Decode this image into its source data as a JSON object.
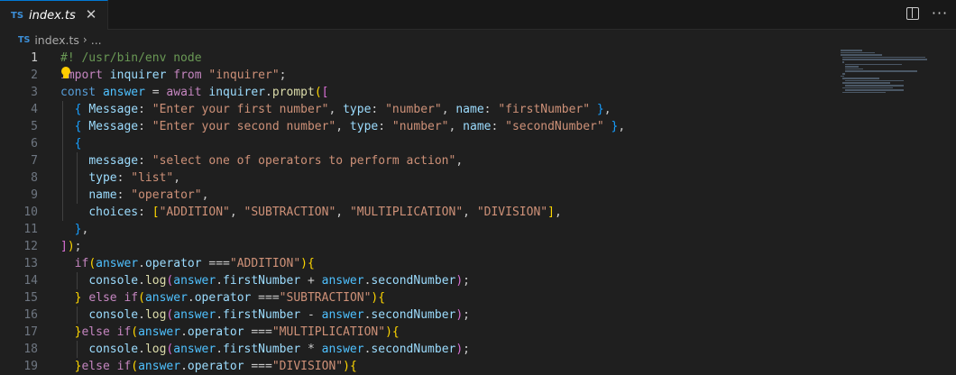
{
  "tab": {
    "icon_label": "TS",
    "file_name": "index.ts",
    "close_glyph": "✕"
  },
  "toolbar": {
    "split_icon": "split-editor-icon",
    "more_glyph": "···"
  },
  "breadcrumb": {
    "icon_label": "TS",
    "file": "index.ts",
    "separator": "›",
    "rest": "..."
  },
  "editor": {
    "active_line": 1,
    "lines": [
      {
        "n": "1",
        "tokens": [
          [
            "comment",
            "#! /usr/bin/env node"
          ]
        ]
      },
      {
        "n": "2",
        "tokens": [
          [
            "keyword",
            "import"
          ],
          [
            "punct",
            " "
          ],
          [
            "var",
            "inquirer"
          ],
          [
            "punct",
            " "
          ],
          [
            "keyword",
            "from"
          ],
          [
            "punct",
            " "
          ],
          [
            "string",
            "\"inquirer\""
          ],
          [
            "punct",
            ";"
          ]
        ]
      },
      {
        "n": "3",
        "tokens": [
          [
            "storage",
            "const"
          ],
          [
            "punct",
            " "
          ],
          [
            "const",
            "answer"
          ],
          [
            "punct",
            " = "
          ],
          [
            "keyword",
            "await"
          ],
          [
            "punct",
            " "
          ],
          [
            "var",
            "inquirer"
          ],
          [
            "punct",
            "."
          ],
          [
            "fn",
            "prompt"
          ],
          [
            "bracket1",
            "("
          ],
          [
            "bracket2",
            "["
          ]
        ]
      },
      {
        "n": "4",
        "tokens": [
          [
            "punct",
            "  "
          ],
          [
            "bracket3",
            "{"
          ],
          [
            "punct",
            " "
          ],
          [
            "var",
            "Message"
          ],
          [
            "punct",
            ": "
          ],
          [
            "string",
            "\"Enter your first number\""
          ],
          [
            "punct",
            ", "
          ],
          [
            "var",
            "type"
          ],
          [
            "punct",
            ": "
          ],
          [
            "string",
            "\"number\""
          ],
          [
            "punct",
            ", "
          ],
          [
            "var",
            "name"
          ],
          [
            "punct",
            ": "
          ],
          [
            "string",
            "\"firstNumber\""
          ],
          [
            "punct",
            " "
          ],
          [
            "bracket3",
            "}"
          ],
          [
            "punct",
            ","
          ]
        ]
      },
      {
        "n": "5",
        "tokens": [
          [
            "punct",
            "  "
          ],
          [
            "bracket3",
            "{"
          ],
          [
            "punct",
            " "
          ],
          [
            "var",
            "Message"
          ],
          [
            "punct",
            ": "
          ],
          [
            "string",
            "\"Enter your second number\""
          ],
          [
            "punct",
            ", "
          ],
          [
            "var",
            "type"
          ],
          [
            "punct",
            ": "
          ],
          [
            "string",
            "\"number\""
          ],
          [
            "punct",
            ", "
          ],
          [
            "var",
            "name"
          ],
          [
            "punct",
            ": "
          ],
          [
            "string",
            "\"secondNumber\""
          ],
          [
            "punct",
            " "
          ],
          [
            "bracket3",
            "}"
          ],
          [
            "punct",
            ","
          ]
        ]
      },
      {
        "n": "6",
        "tokens": [
          [
            "punct",
            "  "
          ],
          [
            "bracket3",
            "{"
          ]
        ]
      },
      {
        "n": "7",
        "tokens": [
          [
            "punct",
            "    "
          ],
          [
            "var",
            "message"
          ],
          [
            "punct",
            ": "
          ],
          [
            "string",
            "\"select one of operators to perform action\""
          ],
          [
            "punct",
            ","
          ]
        ]
      },
      {
        "n": "8",
        "tokens": [
          [
            "punct",
            "    "
          ],
          [
            "var",
            "type"
          ],
          [
            "punct",
            ": "
          ],
          [
            "string",
            "\"list\""
          ],
          [
            "punct",
            ","
          ]
        ]
      },
      {
        "n": "9",
        "tokens": [
          [
            "punct",
            "    "
          ],
          [
            "var",
            "name"
          ],
          [
            "punct",
            ": "
          ],
          [
            "string",
            "\"operator\""
          ],
          [
            "punct",
            ","
          ]
        ]
      },
      {
        "n": "10",
        "tokens": [
          [
            "punct",
            "    "
          ],
          [
            "var",
            "choices"
          ],
          [
            "punct",
            ": "
          ],
          [
            "bracket1",
            "["
          ],
          [
            "string",
            "\"ADDITION\""
          ],
          [
            "punct",
            ", "
          ],
          [
            "string",
            "\"SUBTRACTION\""
          ],
          [
            "punct",
            ", "
          ],
          [
            "string",
            "\"MULTIPLICATION\""
          ],
          [
            "punct",
            ", "
          ],
          [
            "string",
            "\"DIVISION\""
          ],
          [
            "bracket1",
            "]"
          ],
          [
            "punct",
            ","
          ]
        ]
      },
      {
        "n": "11",
        "tokens": [
          [
            "punct",
            "  "
          ],
          [
            "bracket3",
            "}"
          ],
          [
            "punct",
            ","
          ]
        ]
      },
      {
        "n": "12",
        "tokens": [
          [
            "bracket2",
            "]"
          ],
          [
            "bracket1",
            ")"
          ],
          [
            "punct",
            ";"
          ]
        ]
      },
      {
        "n": "13",
        "tokens": [
          [
            "punct",
            "  "
          ],
          [
            "keyword",
            "if"
          ],
          [
            "bracket1",
            "("
          ],
          [
            "const",
            "answer"
          ],
          [
            "punct",
            "."
          ],
          [
            "var",
            "operator"
          ],
          [
            "punct",
            " ==="
          ],
          [
            "string",
            "\"ADDITION\""
          ],
          [
            "bracket1",
            ")"
          ],
          [
            "bracket1",
            "{"
          ]
        ]
      },
      {
        "n": "14",
        "tokens": [
          [
            "punct",
            "    "
          ],
          [
            "var",
            "console"
          ],
          [
            "punct",
            "."
          ],
          [
            "fn",
            "log"
          ],
          [
            "bracket2",
            "("
          ],
          [
            "const",
            "answer"
          ],
          [
            "punct",
            "."
          ],
          [
            "var",
            "firstNumber"
          ],
          [
            "punct",
            " + "
          ],
          [
            "const",
            "answer"
          ],
          [
            "punct",
            "."
          ],
          [
            "var",
            "secondNumber"
          ],
          [
            "bracket2",
            ")"
          ],
          [
            "punct",
            ";"
          ]
        ]
      },
      {
        "n": "15",
        "tokens": [
          [
            "punct",
            "  "
          ],
          [
            "bracket1",
            "}"
          ],
          [
            "punct",
            " "
          ],
          [
            "keyword",
            "else"
          ],
          [
            "punct",
            " "
          ],
          [
            "keyword",
            "if"
          ],
          [
            "bracket1",
            "("
          ],
          [
            "const",
            "answer"
          ],
          [
            "punct",
            "."
          ],
          [
            "var",
            "operator"
          ],
          [
            "punct",
            " ==="
          ],
          [
            "string",
            "\"SUBTRACTION\""
          ],
          [
            "bracket1",
            ")"
          ],
          [
            "bracket1",
            "{"
          ]
        ]
      },
      {
        "n": "16",
        "tokens": [
          [
            "punct",
            "    "
          ],
          [
            "var",
            "console"
          ],
          [
            "punct",
            "."
          ],
          [
            "fn",
            "log"
          ],
          [
            "bracket2",
            "("
          ],
          [
            "const",
            "answer"
          ],
          [
            "punct",
            "."
          ],
          [
            "var",
            "firstNumber"
          ],
          [
            "punct",
            " - "
          ],
          [
            "const",
            "answer"
          ],
          [
            "punct",
            "."
          ],
          [
            "var",
            "secondNumber"
          ],
          [
            "bracket2",
            ")"
          ],
          [
            "punct",
            ";"
          ]
        ]
      },
      {
        "n": "17",
        "tokens": [
          [
            "punct",
            "  "
          ],
          [
            "bracket1",
            "}"
          ],
          [
            "keyword",
            "else"
          ],
          [
            "punct",
            " "
          ],
          [
            "keyword",
            "if"
          ],
          [
            "bracket1",
            "("
          ],
          [
            "const",
            "answer"
          ],
          [
            "punct",
            "."
          ],
          [
            "var",
            "operator"
          ],
          [
            "punct",
            " ==="
          ],
          [
            "string",
            "\"MULTIPLICATION\""
          ],
          [
            "bracket1",
            ")"
          ],
          [
            "bracket1",
            "{"
          ]
        ]
      },
      {
        "n": "18",
        "tokens": [
          [
            "punct",
            "    "
          ],
          [
            "var",
            "console"
          ],
          [
            "punct",
            "."
          ],
          [
            "fn",
            "log"
          ],
          [
            "bracket2",
            "("
          ],
          [
            "const",
            "answer"
          ],
          [
            "punct",
            "."
          ],
          [
            "var",
            "firstNumber"
          ],
          [
            "punct",
            " * "
          ],
          [
            "const",
            "answer"
          ],
          [
            "punct",
            "."
          ],
          [
            "var",
            "secondNumber"
          ],
          [
            "bracket2",
            ")"
          ],
          [
            "punct",
            ";"
          ]
        ]
      },
      {
        "n": "19",
        "tokens": [
          [
            "punct",
            "  "
          ],
          [
            "bracket1",
            "}"
          ],
          [
            "keyword",
            "else"
          ],
          [
            "punct",
            " "
          ],
          [
            "keyword",
            "if"
          ],
          [
            "bracket1",
            "("
          ],
          [
            "const",
            "answer"
          ],
          [
            "punct",
            "."
          ],
          [
            "var",
            "operator"
          ],
          [
            "punct",
            " ==="
          ],
          [
            "string",
            "\"DIVISION\""
          ],
          [
            "bracket1",
            ")"
          ],
          [
            "bracket1",
            "{"
          ]
        ]
      }
    ]
  },
  "colors": {
    "editor_bg": "#1f1f1f",
    "tab_accent": "#0078d4",
    "ts_icon": "#3c8fd8",
    "lightbulb": "#ffcc00"
  },
  "icons": {
    "lightbulb": "lightbulb-icon",
    "close": "close-icon",
    "more": "more-actions-icon"
  }
}
